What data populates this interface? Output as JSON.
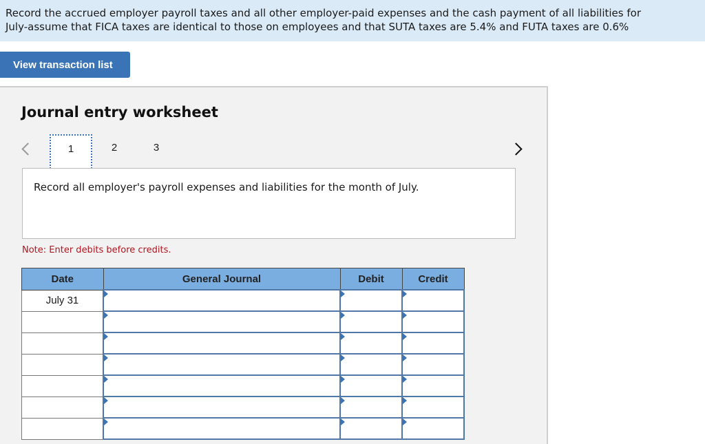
{
  "banner": {
    "line1": "Record the accrued employer payroll taxes and all other employer-paid expenses and the cash payment of all liabilities for",
    "line2": "July-assume that FICA taxes are identical to those on employees and that SUTA taxes are 5.4% and FUTA taxes are 0.6%"
  },
  "toolbar": {
    "view_transactions_label": "View transaction list"
  },
  "worksheet": {
    "title": "Journal entry worksheet",
    "tabs": [
      {
        "label": "1",
        "active": true
      },
      {
        "label": "2"
      },
      {
        "label": "3"
      }
    ],
    "instruction": "Record all employer's payroll expenses and liabilities for the month of July.",
    "note": "Note: Enter debits before credits.",
    "columns": {
      "date": "Date",
      "general_journal": "General Journal",
      "debit": "Debit",
      "credit": "Credit"
    },
    "rows": [
      {
        "date": "July 31",
        "account": "",
        "debit": "",
        "credit": ""
      },
      {
        "date": "",
        "account": "",
        "debit": "",
        "credit": ""
      },
      {
        "date": "",
        "account": "",
        "debit": "",
        "credit": ""
      },
      {
        "date": "",
        "account": "",
        "debit": "",
        "credit": ""
      },
      {
        "date": "",
        "account": "",
        "debit": "",
        "credit": ""
      },
      {
        "date": "",
        "account": "",
        "debit": "",
        "credit": ""
      },
      {
        "date": "",
        "account": "",
        "debit": "",
        "credit": ""
      }
    ]
  },
  "colors": {
    "banner_bg": "#dbeaf7",
    "accent": "#3a74b7",
    "header_bg": "#7aaee1",
    "note": "#b0151f"
  }
}
